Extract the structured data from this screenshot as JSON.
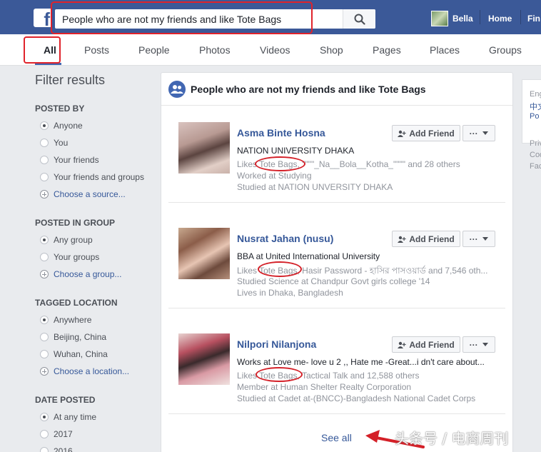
{
  "header": {
    "logo_letter": "f",
    "search_query": "People who are not my friends and like Tote Bags",
    "user_name": "Bella",
    "home_label": "Home",
    "find_label": "Fin"
  },
  "tabs": [
    {
      "label": "All",
      "active": true
    },
    {
      "label": "Posts"
    },
    {
      "label": "People"
    },
    {
      "label": "Photos"
    },
    {
      "label": "Videos"
    },
    {
      "label": "Shop"
    },
    {
      "label": "Pages"
    },
    {
      "label": "Places"
    },
    {
      "label": "Groups"
    }
  ],
  "sidebar": {
    "title": "Filter results",
    "posted_by": {
      "heading": "POSTED BY",
      "options": [
        "Anyone",
        "You",
        "Your friends",
        "Your friends and groups"
      ],
      "selected": 0,
      "link": "Choose a source..."
    },
    "posted_in_group": {
      "heading": "POSTED IN GROUP",
      "options": [
        "Any group",
        "Your groups"
      ],
      "selected": 0,
      "link": "Choose a group..."
    },
    "tagged_location": {
      "heading": "TAGGED LOCATION",
      "options": [
        "Anywhere",
        "Beijing, China",
        "Wuhan, China"
      ],
      "selected": 0,
      "link": "Choose a location..."
    },
    "date_posted": {
      "heading": "DATE POSTED",
      "options": [
        "At any time",
        "2017",
        "2016"
      ],
      "selected": 0
    }
  },
  "results": {
    "title": "People who are not my friends and like Tote Bags",
    "add_friend_label": "Add Friend",
    "more_label": "···",
    "people": [
      {
        "name": "Asma Binte Hosna",
        "line1": "NATION UNIVERSITY DHAKA",
        "likes": "Likes Tote Bags, \"\"\"\"_Na__Bola__Kotha_\"\"\"\" and 28 others",
        "line3": "Worked at Studying",
        "line4": "Studied at NATION UNVERSITY DHAKA"
      },
      {
        "name": "Nusrat Jahan (nusu)",
        "line1": "BBA at United International University",
        "likes": "Likes Tote Bags, Hasir Password - হাসির পাসওয়ার্ড and 7,546 oth...",
        "line3": "Studied Science at Chandpur Govt girls college '14",
        "line4": "Lives in Dhaka, Bangladesh"
      },
      {
        "name": "Nilpori Nilanjona",
        "line1": "Works at Love me- love u 2 ,, Hate me -Great...i dn't care about...",
        "likes": "Likes Tote Bags, Tactical Talk and 12,588 others",
        "line3": "Member at Human Shelter Realty Corporation",
        "line4": "Studied at Cadet at-(BNCC)-Bangladesh National Cadet Corps"
      }
    ],
    "see_all": "See all"
  },
  "right_column": {
    "lines": [
      "Eng",
      "中文",
      "Po",
      "Priv",
      "Coo",
      "Fac"
    ]
  },
  "watermark": "头条号 / 电商周刊",
  "colors": {
    "brand": "#3b5998",
    "link": "#365899",
    "highlight": "#e0232b"
  }
}
